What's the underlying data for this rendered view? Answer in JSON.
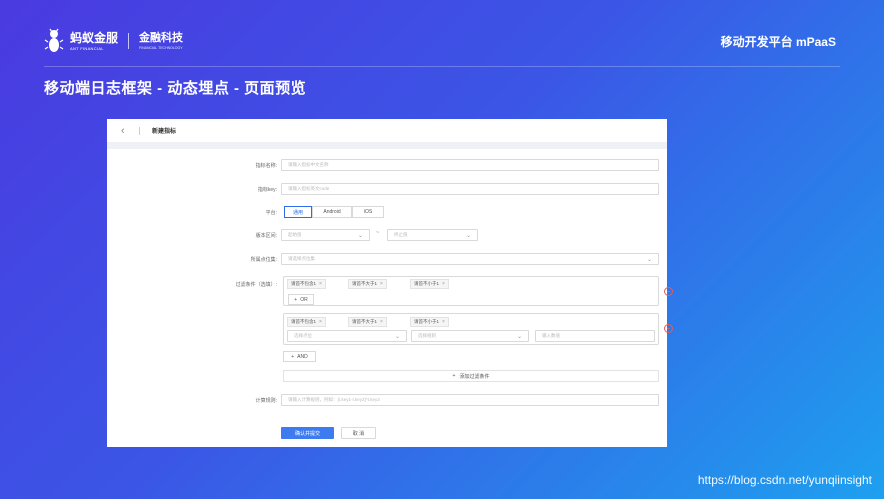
{
  "header": {
    "logo_cn": "蚂蚁金服",
    "logo_en": "ANT FINANCIAL",
    "logo_sub_cn": "金融科技",
    "logo_sub_en": "FINANCIAL TECHNOLOGY",
    "platform": "移动开发平台 mPaaS",
    "slide_title": "移动端日志框架 - 动态埋点 - 页面预览"
  },
  "panel": {
    "back_icon": "‹",
    "title": "新建指标"
  },
  "form": {
    "name_label": "指标名称:",
    "name_placeholder": "请输入指标中文名称",
    "key_label": "指标key:",
    "key_placeholder": "请输入指标英文code",
    "platform_label": "平台:",
    "platform_options": [
      "通用",
      "Android",
      "iOS"
    ],
    "platform_selected": "通用",
    "version_label": "版本区间:",
    "version_start": "起始值",
    "version_tilde": "~",
    "version_end": "终止值",
    "points_label": "所属点位集:",
    "points_placeholder": "请选择点位集",
    "filter_label": "过滤条件（选填）:",
    "group1_tags": [
      "请首不包含1",
      "请首不大于1",
      "请首不小于1"
    ],
    "or_label": "OR",
    "group2_tags": [
      "请首不包含1",
      "请首不大于1",
      "请首不小于1"
    ],
    "select_point": "选择点位",
    "select_rule": "选择规则",
    "input_value": "输入数值",
    "and_label": "AND",
    "add_condition": "添加过滤条件",
    "calc_label": "计算规则:",
    "calc_placeholder": "请输入计算规则，例如：{t.key1-t.key2}*t.key3",
    "confirm": "确认并提交",
    "cancel": "取 消"
  },
  "footer": {
    "watermark": "https://blog.csdn.net/yunqiinsight"
  },
  "colors": {
    "primary": "#3c7cf0",
    "danger": "#e85a5a"
  }
}
